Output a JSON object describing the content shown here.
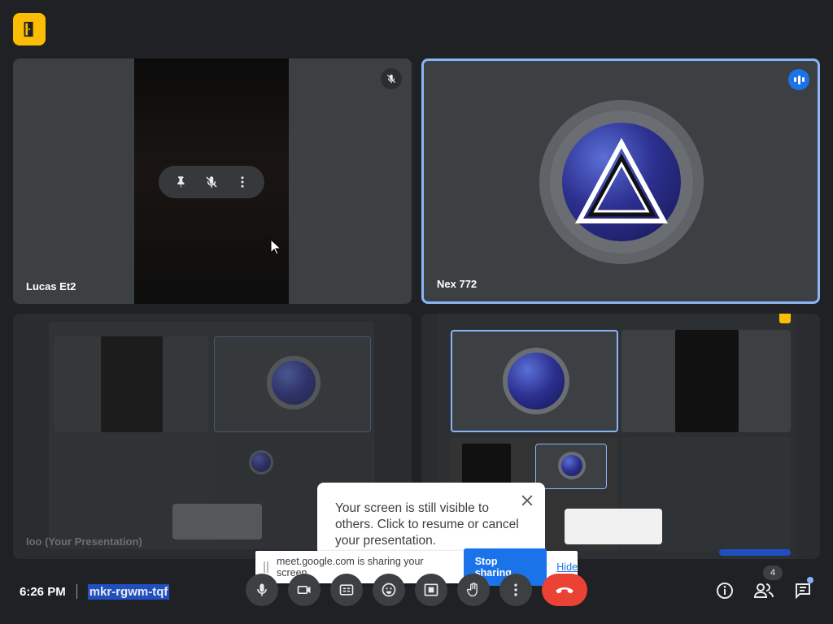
{
  "top_badge": {
    "icon": "door-exit-icon",
    "color": "#fbbc04"
  },
  "tiles": [
    {
      "name": "Lucas Et2",
      "muted": true,
      "hover_actions": [
        "pin-icon",
        "mic-off-icon",
        "more-vert-icon"
      ]
    },
    {
      "name": "Nex 772",
      "speaking": true,
      "active_border": "#8ab4f8"
    },
    {
      "name": "Ioo (Your Presentation)"
    },
    {
      "name": "",
      "content": "recursive screen share"
    }
  ],
  "popup": {
    "text": "Your screen is still visible to others. Click to resume or cancel your presentation."
  },
  "share_bar": {
    "message": "meet.google.com is sharing your screen.",
    "stop_label": "Stop sharing",
    "hide_label": "Hide"
  },
  "meeting": {
    "time": "6:26 PM",
    "code": "mkr-rgwm-tqf"
  },
  "controls": [
    "mic-icon",
    "camera-icon",
    "captions-icon",
    "emoji-icon",
    "present-icon",
    "raise-hand-icon",
    "more-options-icon",
    "end-call-icon"
  ],
  "right_panel": {
    "people_count": "4"
  },
  "colors": {
    "accent": "#1a73e8",
    "end_call": "#ea4335",
    "background": "#202124",
    "tile": "#3c4043"
  }
}
